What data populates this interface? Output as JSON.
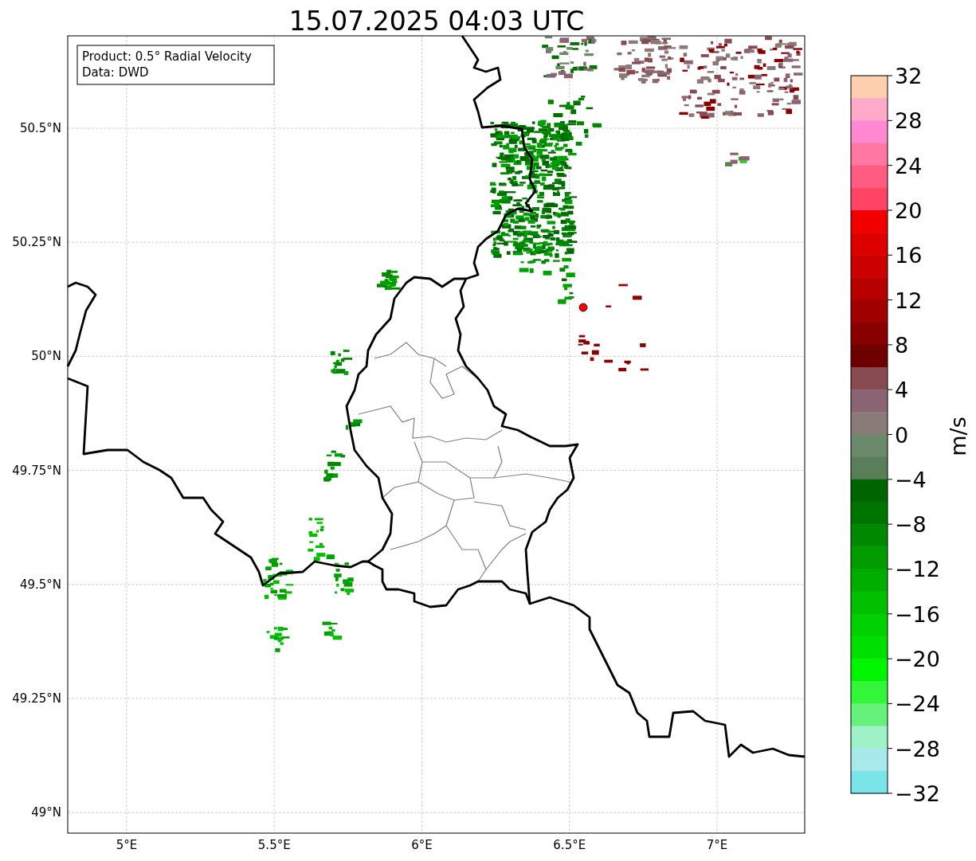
{
  "title": "15.07.2025 04:03 UTC",
  "legend": {
    "lines": [
      "Product: 0.5° Radial Velocity",
      "Data: DWD"
    ]
  },
  "map": {
    "xticks": [
      "5°E",
      "5.5°E",
      "6°E",
      "6.5°E",
      "7°E"
    ],
    "yticks": [
      "50.5°N",
      "50.25°N",
      "50°N",
      "49.75°N",
      "49.5°N",
      "49.25°N",
      "49°N"
    ]
  },
  "colorbar": {
    "label": "m/s",
    "ticks": [
      "32",
      "28",
      "24",
      "20",
      "16",
      "12",
      "8",
      "4",
      "0",
      "−4",
      "−8",
      "−12",
      "−16",
      "−20",
      "−24",
      "−28",
      "−32"
    ],
    "segments": [
      {
        "color": "#ffd0b0"
      },
      {
        "color": "#ffaac8"
      },
      {
        "color": "#ff88d0"
      },
      {
        "color": "#ff78a4"
      },
      {
        "color": "#ff5c84"
      },
      {
        "color": "#ff4466"
      },
      {
        "color": "#f20000"
      },
      {
        "color": "#de0000"
      },
      {
        "color": "#cc0000"
      },
      {
        "color": "#b80000"
      },
      {
        "color": "#a00000"
      },
      {
        "color": "#880000"
      },
      {
        "color": "#6e0000"
      },
      {
        "color": "#864a50"
      },
      {
        "color": "#8a6472"
      },
      {
        "color": "#8a7a78"
      },
      {
        "color": "#6b8a6b"
      },
      {
        "color": "#5a7e5a"
      },
      {
        "color": "#006400"
      },
      {
        "color": "#007400"
      },
      {
        "color": "#008800"
      },
      {
        "color": "#009c00"
      },
      {
        "color": "#00ae00"
      },
      {
        "color": "#00c000"
      },
      {
        "color": "#00d000"
      },
      {
        "color": "#00e000"
      },
      {
        "color": "#00f500"
      },
      {
        "color": "#33f53a"
      },
      {
        "color": "#66f27a"
      },
      {
        "color": "#9ff2c8"
      },
      {
        "color": "#a8eaec"
      },
      {
        "color": "#7ae5e8"
      }
    ]
  }
}
